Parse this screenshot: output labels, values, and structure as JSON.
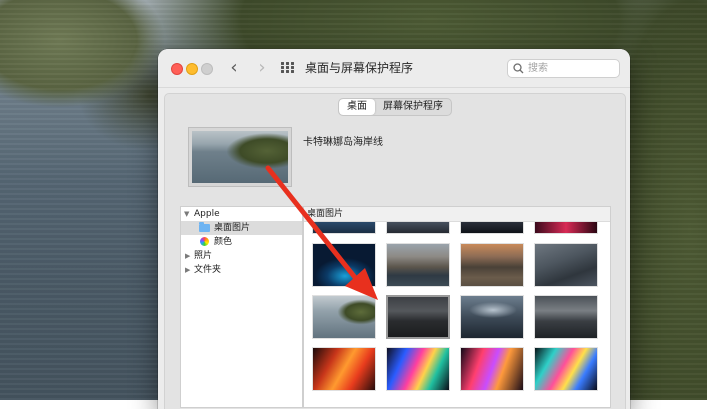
{
  "window": {
    "title": "桌面与屏幕保护程序",
    "search_placeholder": "搜索"
  },
  "tabs": [
    {
      "label": "桌面",
      "active": true
    },
    {
      "label": "屏幕保护程序",
      "active": false
    }
  ],
  "preview": {
    "label": "卡特琳娜岛海岸线"
  },
  "sidebar": {
    "items": [
      {
        "label": "Apple",
        "expanded": true,
        "icon": "disclosure-open"
      },
      {
        "label": "桌面图片",
        "selected": true,
        "icon": "folder-icon"
      },
      {
        "label": "颜色",
        "selected": false,
        "icon": "color-wheel-icon"
      },
      {
        "label": "照片",
        "expanded": false,
        "icon": "disclosure-closed"
      },
      {
        "label": "文件夹",
        "expanded": false,
        "icon": "disclosure-closed"
      }
    ]
  },
  "grid": {
    "header": "桌面图片",
    "selected_index": 4
  },
  "colors": {
    "annotation_arrow": "#e8301e",
    "folder": "#6eb4f2"
  }
}
